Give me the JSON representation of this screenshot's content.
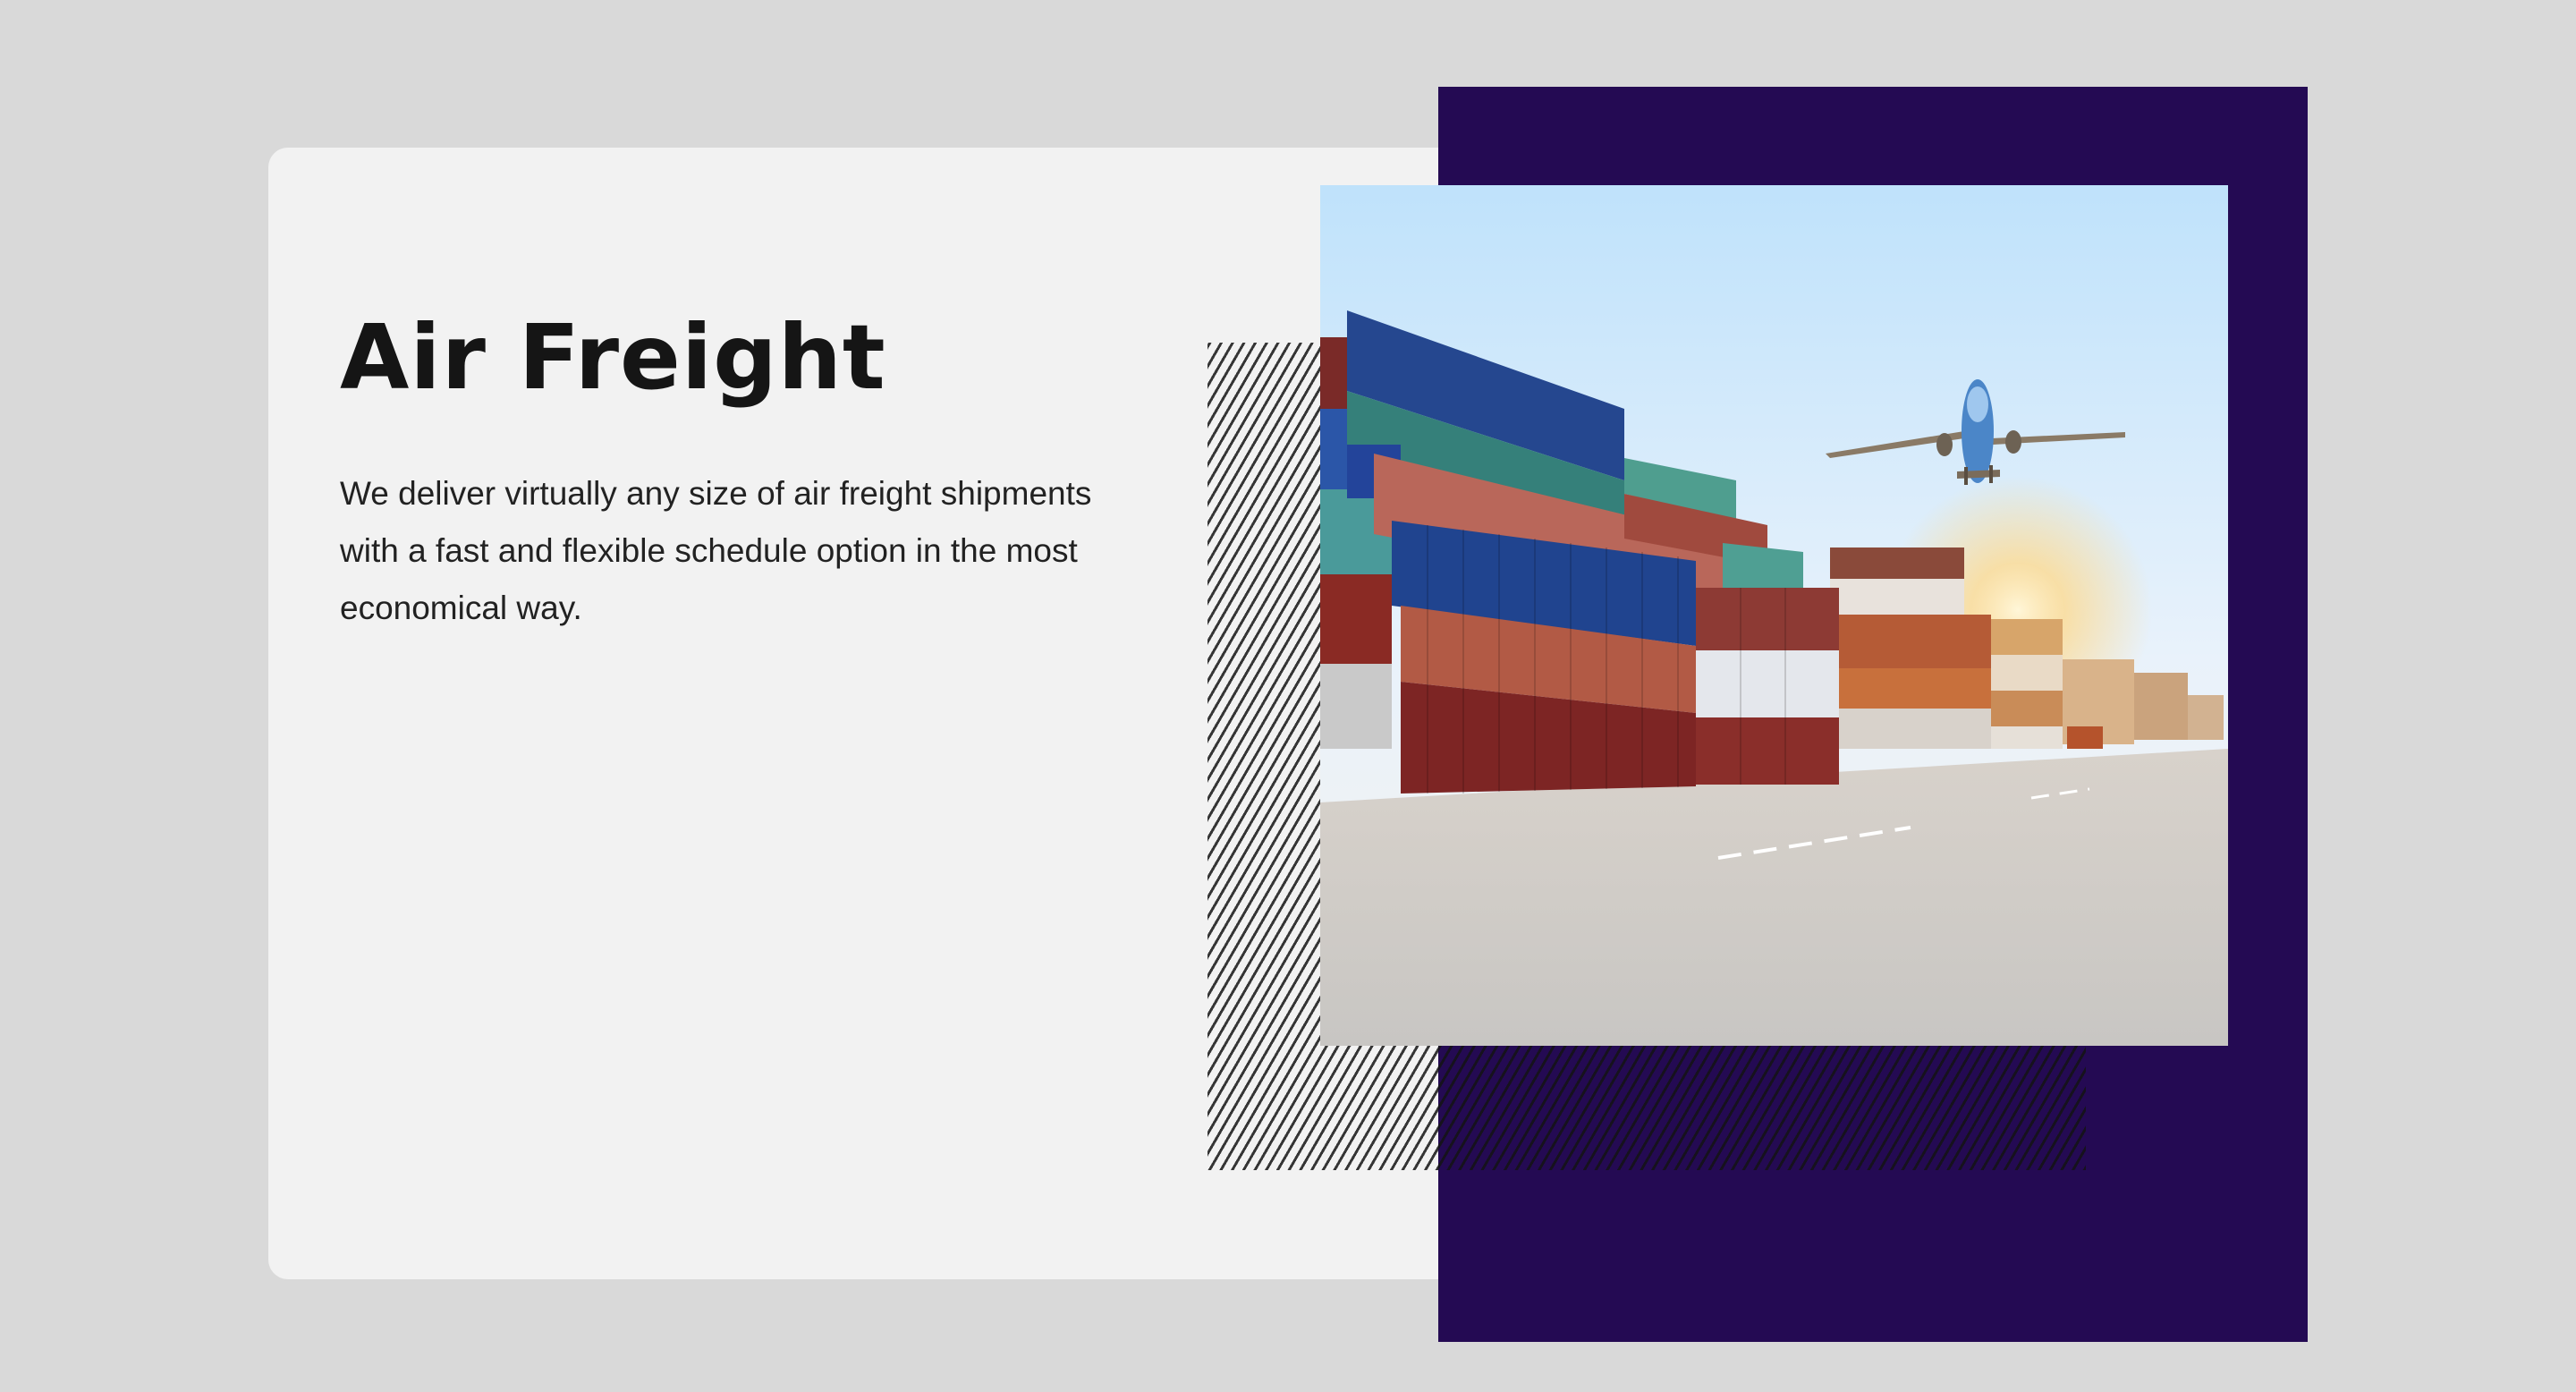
{
  "hero": {
    "title": "Air Freight",
    "description": "We deliver virtually any size of air freight shipments with a fast and flexible schedule option in the most economical way."
  },
  "image": {
    "subject": "cargo-containers-and-airplane-photo"
  },
  "colors": {
    "background": "#d9d9d9",
    "card": "#f2f2f2",
    "accent_block": "#240a53",
    "heading": "#151515",
    "body_text": "#222222"
  }
}
